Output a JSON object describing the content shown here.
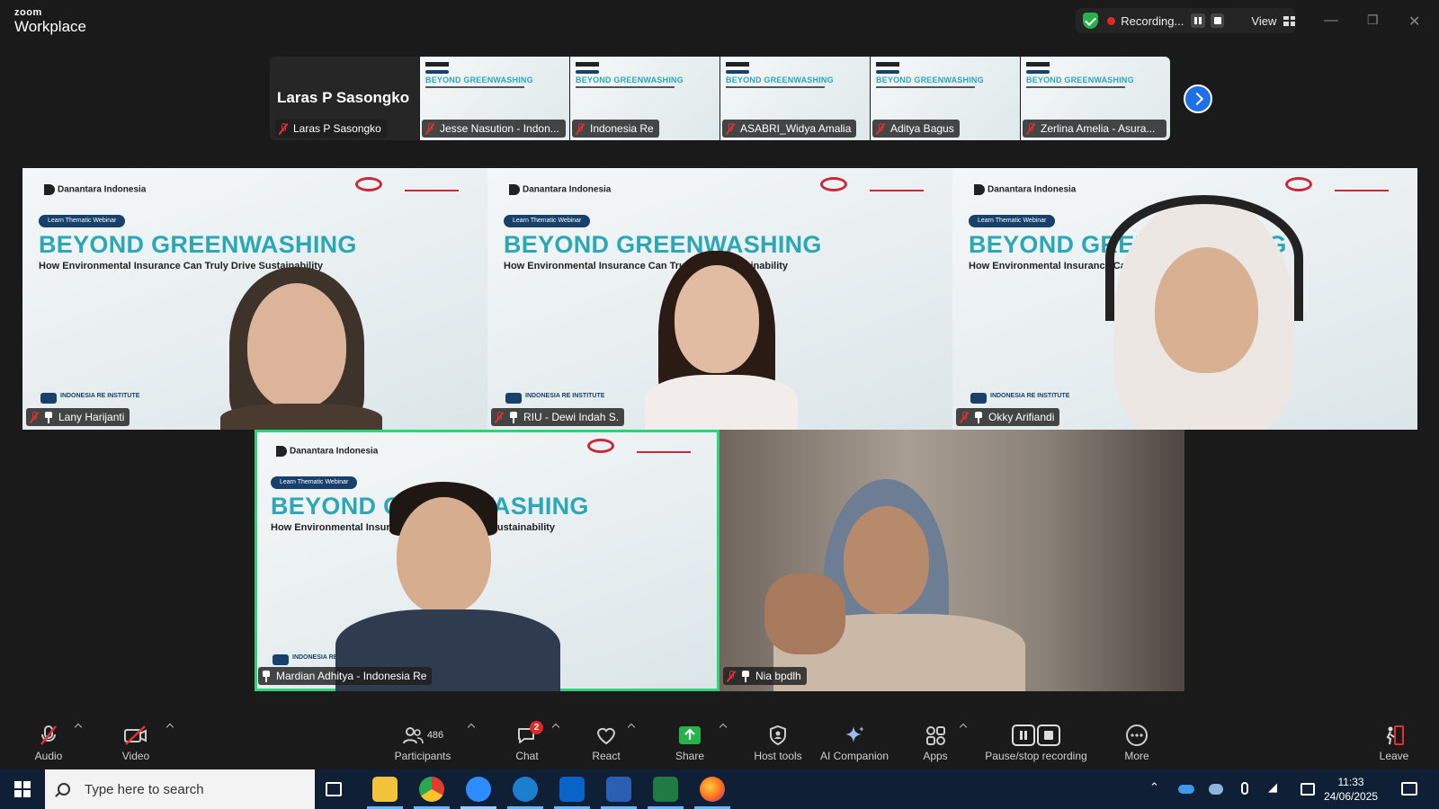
{
  "titlebar": {
    "brand_top": "zoom",
    "brand_bottom": "Workplace",
    "recording_label": "Recording...",
    "view_label": "View"
  },
  "thumbnail_strip": {
    "featured_name": "Laras P Sasongko",
    "featured_tag": "Laras P Sasongko",
    "slide_title": "BEYOND GREENWASHING",
    "participants": [
      "Jesse Nasution - Indon...",
      "Indonesia Re",
      "ASABRI_Widya Amalia",
      "Aditya Bagus",
      "Zerlina Amelia - Asura..."
    ]
  },
  "slide": {
    "logo_left": "Danantara Indonesia",
    "pill": "Learn Thematic Webinar",
    "title": "BEYOND GREENWASHING",
    "subtitle": "How Environmental Insurance Can Truly Drive Sustainability",
    "institute": "INDONESIA RE INSTITUTE"
  },
  "tiles": [
    {
      "name": "Lany Harijanti"
    },
    {
      "name": "RIU - Dewi Indah S."
    },
    {
      "name": "Okky Arifiandi"
    },
    {
      "name": "Mardian Adhitya - Indonesia Re"
    },
    {
      "name": "Nia bpdlh"
    }
  ],
  "toolbar": {
    "audio": "Audio",
    "video": "Video",
    "participants": "Participants",
    "participant_count": "486",
    "chat": "Chat",
    "chat_badge": "2",
    "react": "React",
    "share": "Share",
    "host_tools": "Host tools",
    "ai_companion": "AI Companion",
    "apps": "Apps",
    "pause_stop": "Pause/stop recording",
    "more": "More",
    "leave": "Leave"
  },
  "taskbar": {
    "search_placeholder": "Type here to search",
    "time": "11:33",
    "date": "24/06/2025"
  },
  "colors": {
    "accent_green": "#2dd27a",
    "recording_red": "#e02828",
    "share_green": "#27b24a",
    "zoom_blue": "#1f6fe8",
    "slide_teal": "#2ba7b6"
  }
}
